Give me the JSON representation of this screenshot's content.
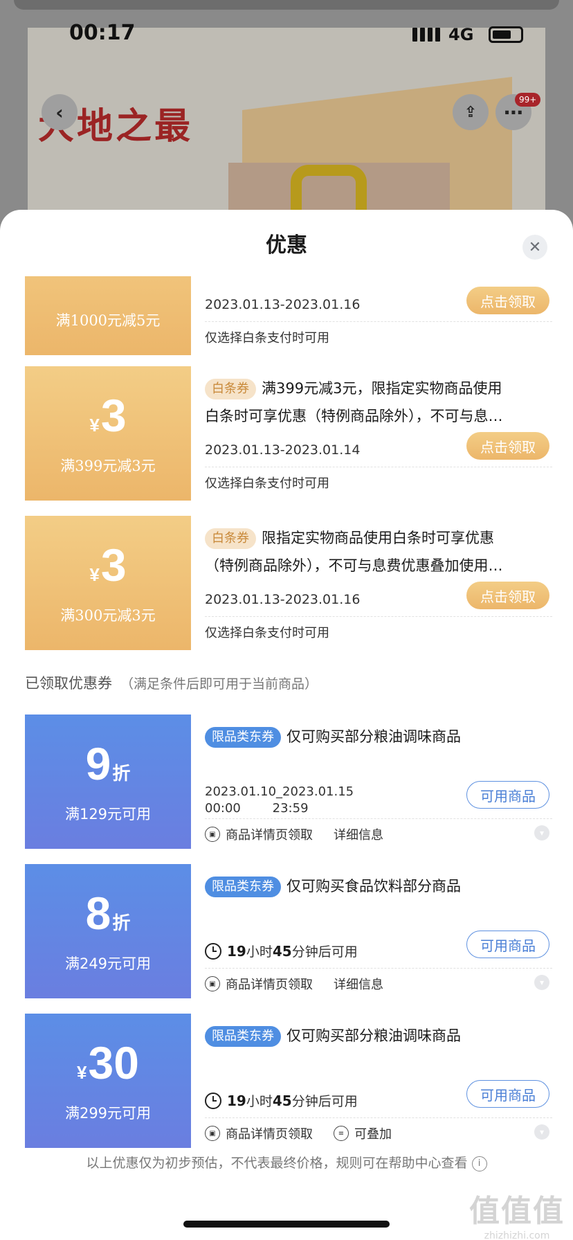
{
  "background": {
    "time": "00:17",
    "network": "4G",
    "brand": "大地之最",
    "cart_badge": "99+"
  },
  "sheet": {
    "title": "优惠",
    "close_icon": "close-icon"
  },
  "unclaimed": [
    {
      "partial": true,
      "threshold": "满1000元减5元",
      "date": "2023.01.13-2023.01.16",
      "button": "点击领取",
      "footnote": "仅选择白条支付时可用"
    },
    {
      "currency": "¥",
      "amount": "3",
      "threshold": "满399元减3元",
      "tag": "白条券",
      "desc_line1": "满399元减3元，限指定实物商品使用",
      "desc_line2": "白条时可享优惠（特例商品除外），不可与息…",
      "date": "2023.01.13-2023.01.14",
      "button": "点击领取",
      "footnote": "仅选择白条支付时可用"
    },
    {
      "currency": "¥",
      "amount": "3",
      "threshold": "满300元减3元",
      "tag": "白条券",
      "desc_line1": "限指定实物商品使用白条时可享优惠",
      "desc_line2": "（特例商品除外），不可与息费优惠叠加使用…",
      "date": "2023.01.13-2023.01.16",
      "button": "点击领取",
      "footnote": "仅选择白条支付时可用"
    }
  ],
  "claimed_section": {
    "title": "已领取优惠券",
    "note": "（满足条件后即可用于当前商品）"
  },
  "claimed": [
    {
      "amount": "9",
      "unit": "折",
      "threshold": "满129元可用",
      "tag": "限品类东券",
      "desc": "仅可购买部分粮油调味商品",
      "date_line1": "2023.01.10_2023.01.15",
      "date_line2": "00:00        23:59",
      "button": "可用商品",
      "source": "商品详情页领取",
      "extra": "详细信息"
    },
    {
      "amount": "8",
      "unit": "折",
      "threshold": "满249元可用",
      "tag": "限品类东券",
      "desc": "仅可购买食品饮料部分商品",
      "timer_hours": "19",
      "timer_h_label": "小时",
      "timer_minutes": "45",
      "timer_m_label": "分钟后可用",
      "button": "可用商品",
      "source": "商品详情页领取",
      "extra": "详细信息"
    },
    {
      "currency": "¥",
      "amount": "30",
      "threshold": "满299元可用",
      "tag": "限品类东券",
      "desc": "仅可购买部分粮油调味商品",
      "timer_hours": "19",
      "timer_h_label": "小时",
      "timer_minutes": "45",
      "timer_m_label": "分钟后可用",
      "button": "可用商品",
      "source": "商品详情页领取",
      "extra": "可叠加"
    }
  ],
  "disclaimer": "以上优惠仅为初步预估，不代表最终价格，规则可在帮助中心查看",
  "watermark": {
    "big": "值值值",
    "small": "zhizhizhi.com"
  },
  "colors": {
    "gold": "#ecb66a",
    "blue": "#5c8ee6"
  }
}
